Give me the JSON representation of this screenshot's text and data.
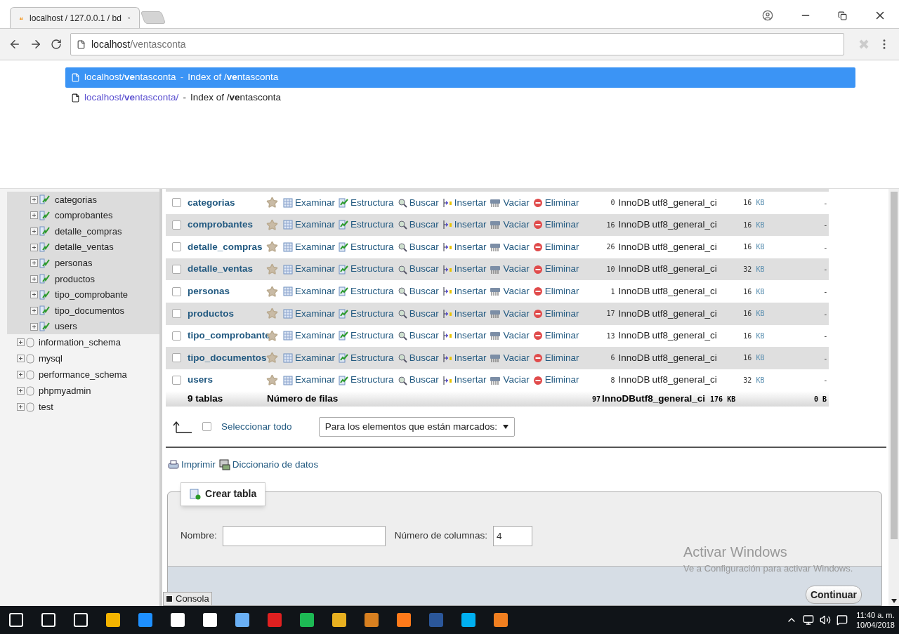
{
  "browser": {
    "tab_title": "localhost / 127.0.0.1 / bd",
    "address": {
      "host": "localhost",
      "path": "/ventasconta"
    },
    "suggestions": [
      {
        "url": "localhost/**ve**ntasconta",
        "separator": "-",
        "title": "Index of /**ve**ntasconta",
        "selected": true
      },
      {
        "url": "localhost/**ve**ntasconta/",
        "separator": "-",
        "title": "Index of /**ve**ntasconta",
        "selected": false
      }
    ]
  },
  "sidebar": {
    "tree": [
      {
        "kind": "database",
        "expanded": true,
        "children": [
          {
            "label": "categorias"
          },
          {
            "label": "comprobantes"
          },
          {
            "label": "detalle_compras"
          },
          {
            "label": "detalle_ventas"
          },
          {
            "label": "personas"
          },
          {
            "label": "productos"
          },
          {
            "label": "tipo_comprobante"
          },
          {
            "label": "tipo_documentos"
          },
          {
            "label": "users"
          }
        ]
      },
      {
        "kind": "database",
        "label": "information_schema",
        "expanded": false
      },
      {
        "kind": "database",
        "label": "mysql",
        "expanded": false
      },
      {
        "kind": "database",
        "label": "performance_schema",
        "expanded": false
      },
      {
        "kind": "database",
        "label": "phpmyadmin",
        "expanded": false
      },
      {
        "kind": "database",
        "label": "test",
        "expanded": false
      }
    ]
  },
  "table": {
    "rows": [
      {
        "name": "categorias",
        "actions": [
          "Examinar",
          "Estructura",
          "Buscar",
          "Insertar",
          "Vaciar",
          "Eliminar"
        ],
        "checked": false,
        "rows": "0",
        "engine": "InnoDB",
        "collation": "utf8_general_ci",
        "size": "16",
        "unit": "KB",
        "overhead": "-"
      },
      {
        "name": "comprobantes",
        "actions": [
          "Examinar",
          "Estructura",
          "Buscar",
          "Insertar",
          "Vaciar",
          "Eliminar"
        ],
        "checked": false,
        "rows": "16",
        "engine": "InnoDB",
        "collation": "utf8_general_ci",
        "size": "16",
        "unit": "KB",
        "overhead": "-"
      },
      {
        "name": "detalle_compras",
        "actions": [
          "Examinar",
          "Estructura",
          "Buscar",
          "Insertar",
          "Vaciar",
          "Eliminar"
        ],
        "checked": false,
        "rows": "26",
        "engine": "InnoDB",
        "collation": "utf8_general_ci",
        "size": "16",
        "unit": "KB",
        "overhead": "-"
      },
      {
        "name": "detalle_ventas",
        "actions": [
          "Examinar",
          "Estructura",
          "Buscar",
          "Insertar",
          "Vaciar",
          "Eliminar"
        ],
        "checked": false,
        "rows": "10",
        "engine": "InnoDB",
        "collation": "utf8_general_ci",
        "size": "32",
        "unit": "KB",
        "overhead": "-"
      },
      {
        "name": "personas",
        "actions": [
          "Examinar",
          "Estructura",
          "Buscar",
          "Insertar",
          "Vaciar",
          "Eliminar"
        ],
        "checked": false,
        "rows": "1",
        "engine": "InnoDB",
        "collation": "utf8_general_ci",
        "size": "16",
        "unit": "KB",
        "overhead": "-"
      },
      {
        "name": "productos",
        "actions": [
          "Examinar",
          "Estructura",
          "Buscar",
          "Insertar",
          "Vaciar",
          "Eliminar"
        ],
        "checked": false,
        "rows": "17",
        "engine": "InnoDB",
        "collation": "utf8_general_ci",
        "size": "16",
        "unit": "KB",
        "overhead": "-"
      },
      {
        "name": "tipo_comprobante",
        "actions": [
          "Examinar",
          "Estructura",
          "Buscar",
          "Insertar",
          "Vaciar",
          "Eliminar"
        ],
        "checked": false,
        "rows": "13",
        "engine": "InnoDB",
        "collation": "utf8_general_ci",
        "size": "16",
        "unit": "KB",
        "overhead": "-"
      },
      {
        "name": "tipo_documentos",
        "actions": [
          "Examinar",
          "Estructura",
          "Buscar",
          "Insertar",
          "Vaciar",
          "Eliminar"
        ],
        "checked": false,
        "rows": "6",
        "engine": "InnoDB",
        "collation": "utf8_general_ci",
        "size": "16",
        "unit": "KB",
        "overhead": "-"
      },
      {
        "name": "users",
        "actions": [
          "Examinar",
          "Estructura",
          "Buscar",
          "Insertar",
          "Vaciar",
          "Eliminar"
        ],
        "checked": false,
        "rows": "8",
        "engine": "InnoDB",
        "collation": "utf8_general_ci",
        "size": "32",
        "unit": "KB",
        "overhead": "-"
      }
    ],
    "footer": {
      "name": "9 tablas",
      "label": "Número de filas",
      "rows": "97",
      "engine": "InnoDB",
      "collation": "utf8_general_ci",
      "size": "176",
      "unit": "KB",
      "overhead": "0 B"
    }
  },
  "bulk": {
    "select_all": "Seleccionar todo",
    "select_all_checked": false,
    "dropdown": "Para los elementos que están marcados:"
  },
  "links": [
    "Imprimir",
    "Diccionario de datos"
  ],
  "create_table": {
    "legend": "Crear tabla",
    "name_label": "Nombre:",
    "columns_label": "Número de columnas:",
    "columns_value": "4",
    "submit": "Continuar"
  },
  "console": "Consola",
  "activation": {
    "title": "Activar Windows",
    "subtitle": "Ve a Configuración para activar Windows."
  },
  "taskbar": {
    "time": "11:40 a. m.",
    "date": "10/04/2018"
  }
}
